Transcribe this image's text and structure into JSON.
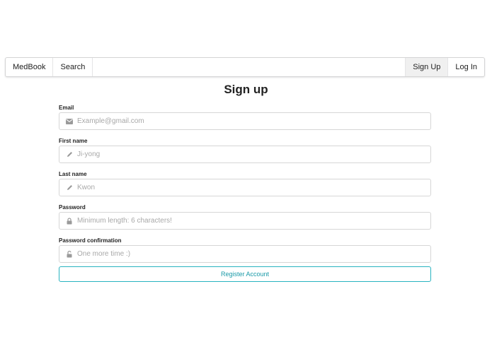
{
  "navbar": {
    "brand": "MedBook",
    "search": "Search",
    "sign_up": "Sign Up",
    "log_in": "Log In"
  },
  "page": {
    "title": "Sign up"
  },
  "form": {
    "email": {
      "label": "Email",
      "placeholder": "Example@gmail.com",
      "icon": "envelope-icon"
    },
    "first_name": {
      "label": "First name",
      "placeholder": "Ji-yong",
      "icon": "pencil-icon"
    },
    "last_name": {
      "label": "Last name",
      "placeholder": "Kwon",
      "icon": "pencil-icon"
    },
    "password": {
      "label": "Password",
      "placeholder": "Minimum length: 6 characters!",
      "icon": "lock-icon"
    },
    "password_confirmation": {
      "label": "Password confirmation",
      "placeholder": "One more time :)",
      "icon": "unlock-icon"
    },
    "submit_label": "Register Account"
  },
  "colors": {
    "accent": "#28b3c0",
    "accent_text": "#1a9aa8",
    "active_tab_bg": "#f0f0f0"
  }
}
